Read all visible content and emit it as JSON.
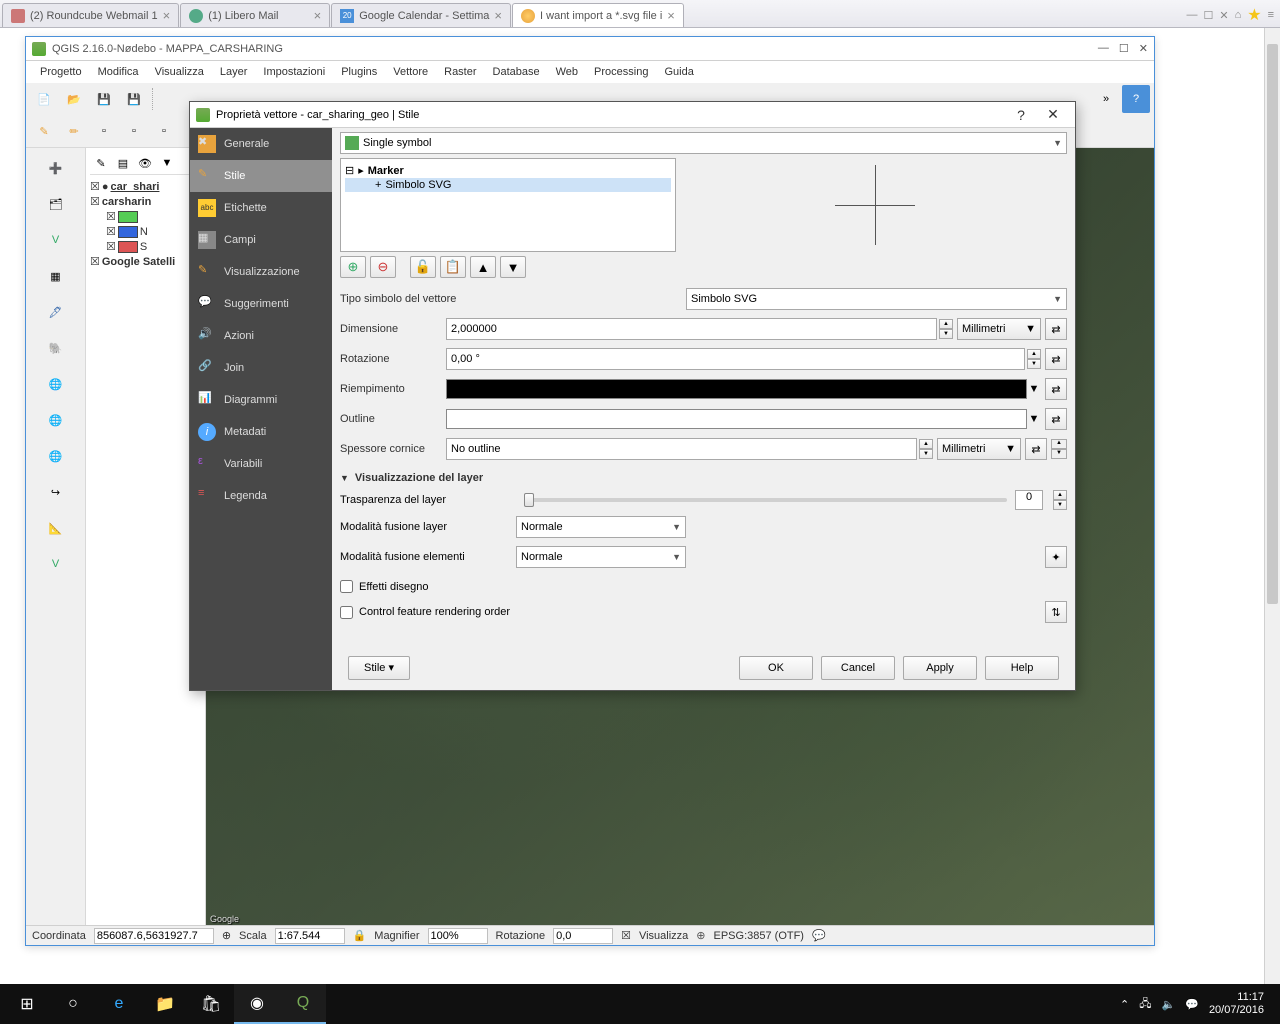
{
  "browser": {
    "tabs": [
      {
        "label": "(2) Roundcube Webmail 1",
        "icon": "#c77"
      },
      {
        "label": "(1) Libero Mail",
        "icon": "#5a8"
      },
      {
        "label": "Google Calendar - Settima",
        "icon": "#4a90d9",
        "badge": "20"
      },
      {
        "label": "I want import a *.svg file i",
        "icon": "#e8a33d",
        "active": true
      }
    ]
  },
  "qgis": {
    "title": "QGIS 2.16.0-Nødebo - MAPPA_CARSHARING",
    "menu": [
      "Progetto",
      "Modifica",
      "Visualizza",
      "Layer",
      "Impostazioni",
      "Plugins",
      "Vettore",
      "Raster",
      "Database",
      "Web",
      "Processing",
      "Guida"
    ],
    "layers": {
      "l1": "car_shari",
      "l2": "carsharin",
      "sub_n": "N",
      "sub_s": "S",
      "l3": "Google Satelli"
    },
    "status": {
      "coord_label": "Coordinata",
      "coord": "856087.6,5631927.7",
      "scale_label": "Scala",
      "scale": "1:67.544",
      "mag_label": "Magnifier",
      "mag": "100%",
      "rot_label": "Rotazione",
      "rot": "0,0",
      "render_label": "Visualizza",
      "crs": "EPSG:3857 (OTF)"
    },
    "map_attr": "Google"
  },
  "dialog": {
    "title": "Proprietà vettore - car_sharing_geo | Stile",
    "sidebar": [
      "Generale",
      "Stile",
      "Etichette",
      "Campi",
      "Visualizzazione",
      "Suggerimenti",
      "Azioni",
      "Join",
      "Diagrammi",
      "Metadati",
      "Variabili",
      "Legenda"
    ],
    "symbol_type": "Single symbol",
    "tree": {
      "marker": "Marker",
      "svg": "Simbolo SVG"
    },
    "form": {
      "tipo_label": "Tipo simbolo del vettore",
      "tipo_value": "Simbolo SVG",
      "dim_label": "Dimensione",
      "dim_value": "2,000000",
      "dim_unit": "Millimetri",
      "rot_label": "Rotazione",
      "rot_value": "0,00 °",
      "riemp_label": "Riempimento",
      "outline_label": "Outline",
      "spess_label": "Spessore cornice",
      "spess_value": "No outline",
      "spess_unit": "Millimetri"
    },
    "viz": {
      "header": "Visualizzazione del layer",
      "transp_label": "Trasparenza del layer",
      "transp_value": "0",
      "blend_layer_label": "Modalità fusione layer",
      "blend_layer_value": "Normale",
      "blend_elem_label": "Modalità fusione elementi",
      "blend_elem_value": "Normale",
      "effects_label": "Effetti disegno",
      "control_label": "Control feature rendering order"
    },
    "buttons": {
      "style": "Stile",
      "ok": "OK",
      "cancel": "Cancel",
      "apply": "Apply",
      "help": "Help"
    }
  },
  "taskbar": {
    "time": "11:17",
    "date": "20/07/2016"
  }
}
